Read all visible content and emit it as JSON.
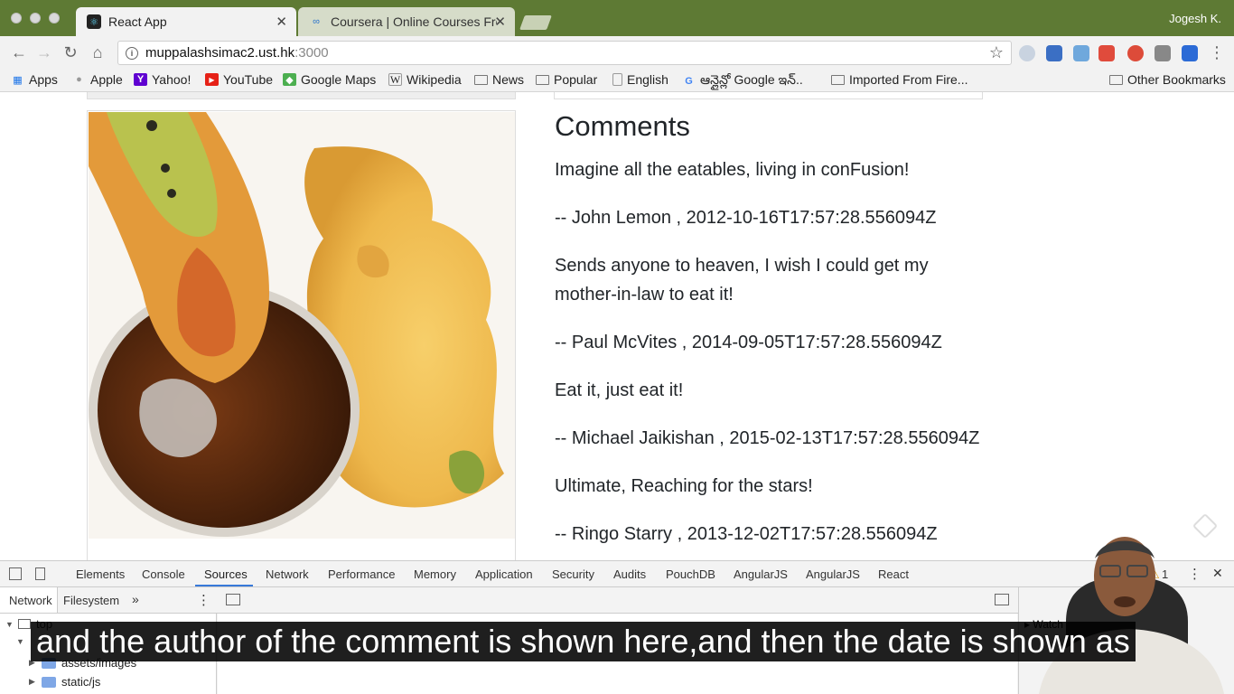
{
  "browser": {
    "tabs": [
      {
        "title": "React App",
        "active": true
      },
      {
        "title": "Coursera | Online Courses Fro",
        "active": false
      }
    ],
    "profile_name": "Jogesh K.",
    "url_host": "muppalashsimac2.ust.hk",
    "url_port": ":3000",
    "bookmarks": [
      {
        "label": "Apps",
        "icon": "apps-grid-icon"
      },
      {
        "label": "Apple",
        "icon": "apple-icon"
      },
      {
        "label": "Yahoo!",
        "icon": "yahoo-icon"
      },
      {
        "label": "YouTube",
        "icon": "youtube-icon"
      },
      {
        "label": "Google Maps",
        "icon": "google-maps-icon"
      },
      {
        "label": "Wikipedia",
        "icon": "wikipedia-icon"
      },
      {
        "label": "News",
        "icon": "folder-icon"
      },
      {
        "label": "Popular",
        "icon": "folder-icon"
      },
      {
        "label": "English",
        "icon": "page-icon"
      },
      {
        "label": "ఆన్లైన్లో Google ఇన్..",
        "icon": "google-icon"
      },
      {
        "label": "Imported From Fire...",
        "icon": "folder-icon"
      }
    ],
    "other_bookmarks": "Other Bookmarks"
  },
  "page": {
    "comments_heading": "Comments",
    "comments": [
      {
        "text": "Imagine all the eatables, living in conFusion!",
        "byline": "-- John Lemon , 2012-10-16T17:57:28.556094Z"
      },
      {
        "text": "Sends anyone to heaven, I wish I could get my mother-in-law to eat it!",
        "byline": "-- Paul McVites , 2014-09-05T17:57:28.556094Z"
      },
      {
        "text": "Eat it, just eat it!",
        "byline": "-- Michael Jaikishan , 2015-02-13T17:57:28.556094Z"
      },
      {
        "text": "Ultimate, Reaching for the stars!",
        "byline": "-- Ringo Starry , 2013-12-02T17:57:28.556094Z"
      }
    ]
  },
  "devtools": {
    "tabs": [
      "Elements",
      "Console",
      "Sources",
      "Network",
      "Performance",
      "Memory",
      "Application",
      "Security",
      "Audits",
      "PouchDB",
      "AngularJS",
      "AngularJS",
      "React"
    ],
    "active_tab": "Sources",
    "warning_count": "1",
    "nav_tabs": [
      "Network",
      "Filesystem"
    ],
    "tree": [
      "top",
      "assets/images",
      "static/js"
    ],
    "watch_label": "Watch"
  },
  "caption": "and the author of the comment is shown here,and then the date is shown as",
  "colors": {
    "tabstrip": "#5e7a34",
    "devtools_accent": "#3879d9",
    "caption_bg": "#000000"
  }
}
